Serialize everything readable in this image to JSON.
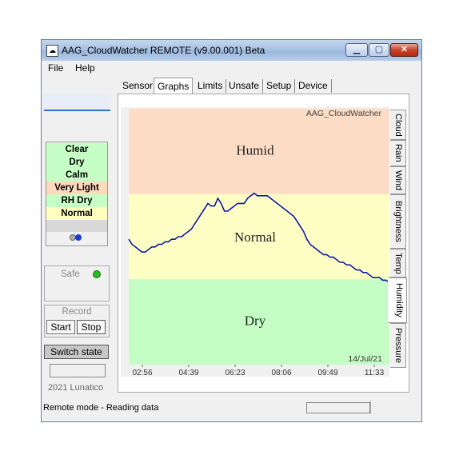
{
  "window": {
    "title": "AAG_CloudWatcher REMOTE (v9.00.001) Beta"
  },
  "menu": [
    "File",
    "Help"
  ],
  "tabs": [
    "Sensor",
    "Graphs",
    "Limits",
    "Unsafe",
    "Setup",
    "Device"
  ],
  "active_tab": "Graphs",
  "conditions": [
    {
      "label": "Clear",
      "color": "#c6ffc6"
    },
    {
      "label": "Dry",
      "color": "#c6ffc6"
    },
    {
      "label": "Calm",
      "color": "#c6ffc6"
    },
    {
      "label": "Very Light",
      "color": "#ffd9bc"
    },
    {
      "label": "RH Dry",
      "color": "#c6ffc6"
    },
    {
      "label": "Normal",
      "color": "#ffffc0"
    }
  ],
  "safe_label": "Safe",
  "record": {
    "label": "Record",
    "start": "Start",
    "stop": "Stop"
  },
  "switch_state": "Switch state",
  "copyright": "2021 Lunatico",
  "status": "Remote mode - Reading data",
  "side_tabs": [
    "Cloud",
    "Rain",
    "Wind",
    "Brightness",
    "Temp",
    "Humidity",
    "Pressure"
  ],
  "active_side_tab": "Humidity",
  "chart_data": {
    "type": "line",
    "watermark": "AAG_CloudWatcher",
    "date": "14/Jul/21",
    "x_ticks": [
      "02:56",
      "04:39",
      "06:23",
      "08:06",
      "09:49",
      "11:33"
    ],
    "zones": [
      {
        "label": "Humid",
        "color": "#fcdcc4"
      },
      {
        "label": "Normal",
        "color": "#fefec4"
      },
      {
        "label": "Dry",
        "color": "#c4fec4"
      }
    ],
    "series": [
      {
        "color": "#0a1aa8",
        "values": [
          49,
          47,
          46,
          45,
          44,
          44,
          45,
          46,
          46,
          47,
          47,
          48,
          48,
          49,
          49,
          50,
          50,
          51,
          52,
          53,
          55,
          57,
          59,
          61,
          63,
          62,
          62,
          65,
          63,
          60,
          60,
          61,
          62,
          63,
          63,
          63,
          65,
          66,
          67,
          66,
          66,
          66,
          66,
          65,
          64,
          63,
          62,
          61,
          60,
          59,
          58,
          56,
          54,
          52,
          49,
          47,
          46,
          45,
          44,
          43,
          43,
          42,
          42,
          41,
          40,
          40,
          39,
          39,
          38,
          37,
          37,
          36,
          36,
          35,
          34,
          34,
          34,
          33,
          33,
          32
        ]
      }
    ]
  }
}
